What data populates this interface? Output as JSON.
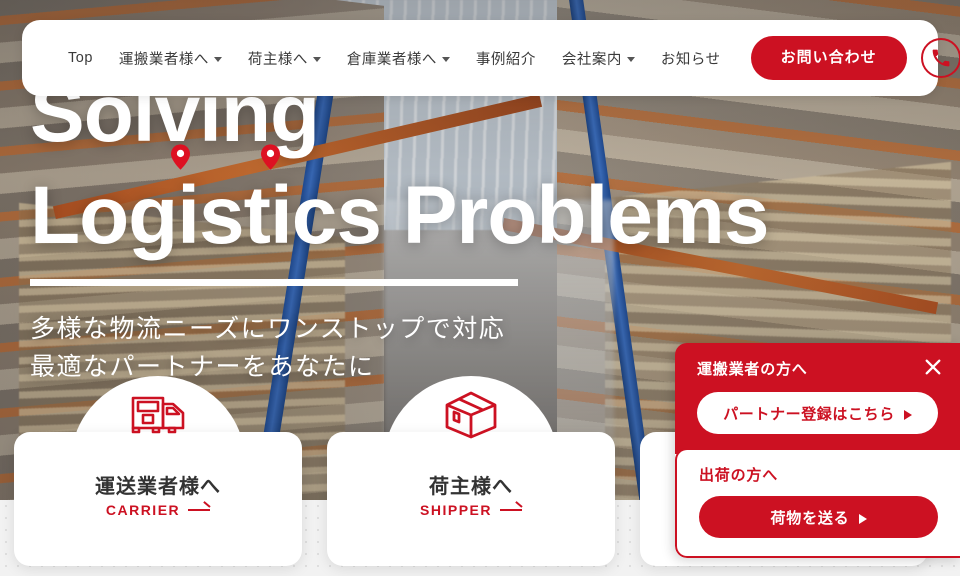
{
  "nav": {
    "items": [
      {
        "label": "Top",
        "has_dropdown": false
      },
      {
        "label": "運搬業者様へ",
        "has_dropdown": true
      },
      {
        "label": "荷主様へ",
        "has_dropdown": true
      },
      {
        "label": "倉庫業者様へ",
        "has_dropdown": true
      },
      {
        "label": "事例紹介",
        "has_dropdown": false
      },
      {
        "label": "会社案内",
        "has_dropdown": true
      },
      {
        "label": "お知らせ",
        "has_dropdown": false
      }
    ],
    "contact_label": "お問い合わせ",
    "phone_icon": "phone-icon"
  },
  "hero": {
    "headline_line1": "Solving",
    "headline_line2": "Logistics Problems",
    "subtitle_line1": "多様な物流ニーズにワンストップで対応",
    "subtitle_line2": "最適なパートナーをあなたに",
    "pin_icon": "map-pin-icon"
  },
  "cards": [
    {
      "icon": "truck-icon",
      "title": "運送業者様へ",
      "subtitle": "CARRIER"
    },
    {
      "icon": "package-box-icon",
      "title": "荷主様へ",
      "subtitle": "SHIPPER"
    },
    {
      "icon": "warehouse-icon",
      "title": "",
      "subtitle": ""
    }
  ],
  "float_panel": {
    "close_icon": "close-icon",
    "top_heading": "運搬業者の方へ",
    "top_button": "パートナー登録はこちら",
    "bottom_heading": "出荷の方へ",
    "bottom_button": "荷物を送る"
  },
  "colors": {
    "brand_red": "#cc1122",
    "text_dark": "#333333",
    "page_bg": "#f2f2f2",
    "white": "#ffffff"
  }
}
